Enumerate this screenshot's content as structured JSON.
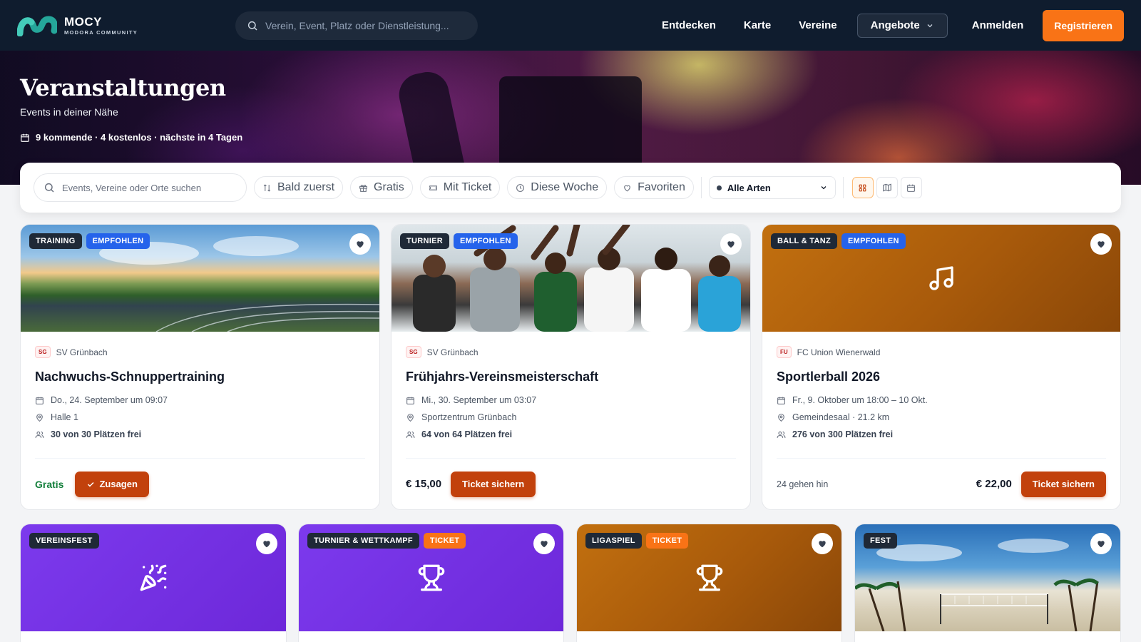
{
  "brand": {
    "name": "MOCY",
    "subtitle": "MODORA COMMUNITY"
  },
  "nav": {
    "search_placeholder": "Verein, Event, Platz oder Dienstleistung...",
    "links": [
      "Entdecken",
      "Karte",
      "Vereine"
    ],
    "dropdown_label": "Angebote",
    "login_label": "Anmelden",
    "register_label": "Registrieren"
  },
  "hero": {
    "title": "Veranstaltungen",
    "subtitle": "Events in deiner Nähe",
    "stats": "9 kommende · 4 kostenlos · nächste in 4 Tagen"
  },
  "filters": {
    "search_placeholder": "Events, Vereine oder Orte suchen",
    "chips": [
      {
        "label": "Bald zuerst",
        "icon": "sort-icon"
      },
      {
        "label": "Gratis",
        "icon": "gift-icon"
      },
      {
        "label": "Mit Ticket",
        "icon": "ticket-icon"
      },
      {
        "label": "Diese Woche",
        "icon": "clock-icon"
      },
      {
        "label": "Favoriten",
        "icon": "heart-icon"
      }
    ],
    "type_select": "Alle Arten",
    "views": [
      "grid-view-icon",
      "map-view-icon",
      "calendar-view-icon"
    ]
  },
  "events": [
    {
      "tags": [
        "TRAINING",
        "EMPFOHLEN"
      ],
      "club_abbr": "SG",
      "club": "SV Grünbach",
      "title": "Nachwuchs-Schnuppertraining",
      "date": "Do., 24. September um 09:07",
      "location": "Halle 1",
      "seats": "30 von 30 Plätzen frei",
      "price_label": "Gratis",
      "action": "Zusagen"
    },
    {
      "tags": [
        "TURNIER",
        "EMPFOHLEN"
      ],
      "club_abbr": "SG",
      "club": "SV Grünbach",
      "title": "Frühjahrs-Vereinsmeisterschaft",
      "date": "Mi., 30. September um 03:07",
      "location": "Sportzentrum Grünbach",
      "seats": "64 von 64 Plätzen frei",
      "price_label": "€ 15,00",
      "action": "Ticket sichern"
    },
    {
      "tags": [
        "BALL & TANZ",
        "EMPFOHLEN"
      ],
      "club_abbr": "FU",
      "club": "FC Union Wienerwald",
      "title": "Sportlerball 2026",
      "date": "Fr., 9. Oktober um 18:00 – 10 Okt.",
      "location": "Gemeindesaal · 21.2 km",
      "seats": "276 von 300 Plätzen frei",
      "going": "24 gehen hin",
      "price_label": "€ 22,00",
      "action": "Ticket sichern"
    }
  ],
  "events_row2": [
    {
      "tags": [
        "VEREINSFEST"
      ]
    },
    {
      "tags": [
        "TURNIER & WETTKAMPF",
        "TICKET"
      ]
    },
    {
      "tags": [
        "LIGASPIEL",
        "TICKET"
      ]
    },
    {
      "tags": [
        "FEST"
      ]
    }
  ],
  "colors": {
    "nav_bg": "#0f1c2e",
    "accent": "#f97316",
    "cta": "#c2410c",
    "purple": "#7c3aed",
    "amber": "#b45309"
  }
}
